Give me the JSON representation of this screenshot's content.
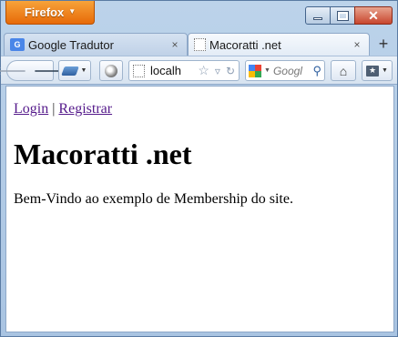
{
  "browser": {
    "menu_button_label": "Firefox",
    "controls": {
      "close_glyph": "✕"
    },
    "tabs": [
      {
        "title": "Google Tradutor",
        "favicon": "google-translate-icon",
        "close": "×",
        "active": false
      },
      {
        "title": "Macoratti .net",
        "favicon": "blank-page-icon",
        "close": "×",
        "active": true
      }
    ],
    "new_tab_glyph": "+",
    "url": "localh",
    "search_placeholder": "Googl"
  },
  "page": {
    "login_link": "Login",
    "separator": "|",
    "register_link": "Registrar",
    "heading": "Macoratti .net",
    "welcome_text": "Bem-Vindo ao exemplo de Membership do site."
  },
  "colors": {
    "firefox_button": "#e76a08",
    "chrome_blue": "#bcd3ea",
    "visited_link": "#551a8b"
  }
}
